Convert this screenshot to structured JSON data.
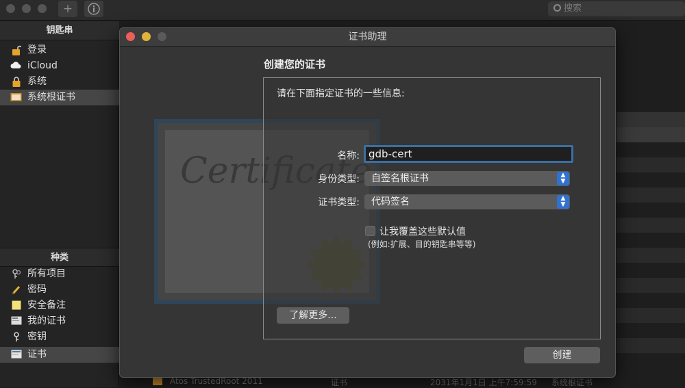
{
  "background_window": {
    "search_placeholder": "搜索",
    "sidebar": {
      "keychains_heading": "钥匙串",
      "keychains": [
        {
          "label": "登录",
          "icon": "unlocked-padlock-icon"
        },
        {
          "label": "iCloud",
          "icon": "cloud-icon"
        },
        {
          "label": "系统",
          "icon": "locked-padlock-icon"
        },
        {
          "label": "系统根证书",
          "icon": "certificate-folder-icon",
          "selected": true
        }
      ],
      "categories_heading": "种类",
      "categories": [
        {
          "label": "所有项目",
          "icon": "keys-icon"
        },
        {
          "label": "密码",
          "icon": "pencil-icon"
        },
        {
          "label": "安全备注",
          "icon": "note-icon"
        },
        {
          "label": "我的证书",
          "icon": "my-certificate-icon"
        },
        {
          "label": "密钥",
          "icon": "key-icon"
        },
        {
          "label": "证书",
          "icon": "certificate-icon",
          "selected": true
        }
      ]
    },
    "bottom_row": {
      "name": "Atos TrustedRoot 2011",
      "kind": "证书",
      "expires": "2031年1月1日 上午7:59:59",
      "keychain": "系统根证书"
    }
  },
  "dialog": {
    "title": "证书助理",
    "section_title": "创建您的证书",
    "prompt": "请在下面指定证书的一些信息:",
    "fields": {
      "name_label": "名称:",
      "name_value": "gdb-cert",
      "identity_type_label": "身份类型:",
      "identity_type_value": "自签名根证书",
      "certificate_type_label": "证书类型:",
      "certificate_type_value": "代码签名"
    },
    "override_checkbox_label": "让我覆盖这些默认值",
    "override_checked": false,
    "override_note": "(例如:扩展、目的钥匙串等等)",
    "learn_more_button": "了解更多...",
    "create_button": "创建",
    "cert_art_text": "Certificate"
  },
  "colors": {
    "close": "#ec5f57",
    "minimize": "#e0b33a",
    "zoom_inactive": "#5a5a5a",
    "focus_ring": "#3a6fa3",
    "select_accent": "#2f72d4"
  }
}
